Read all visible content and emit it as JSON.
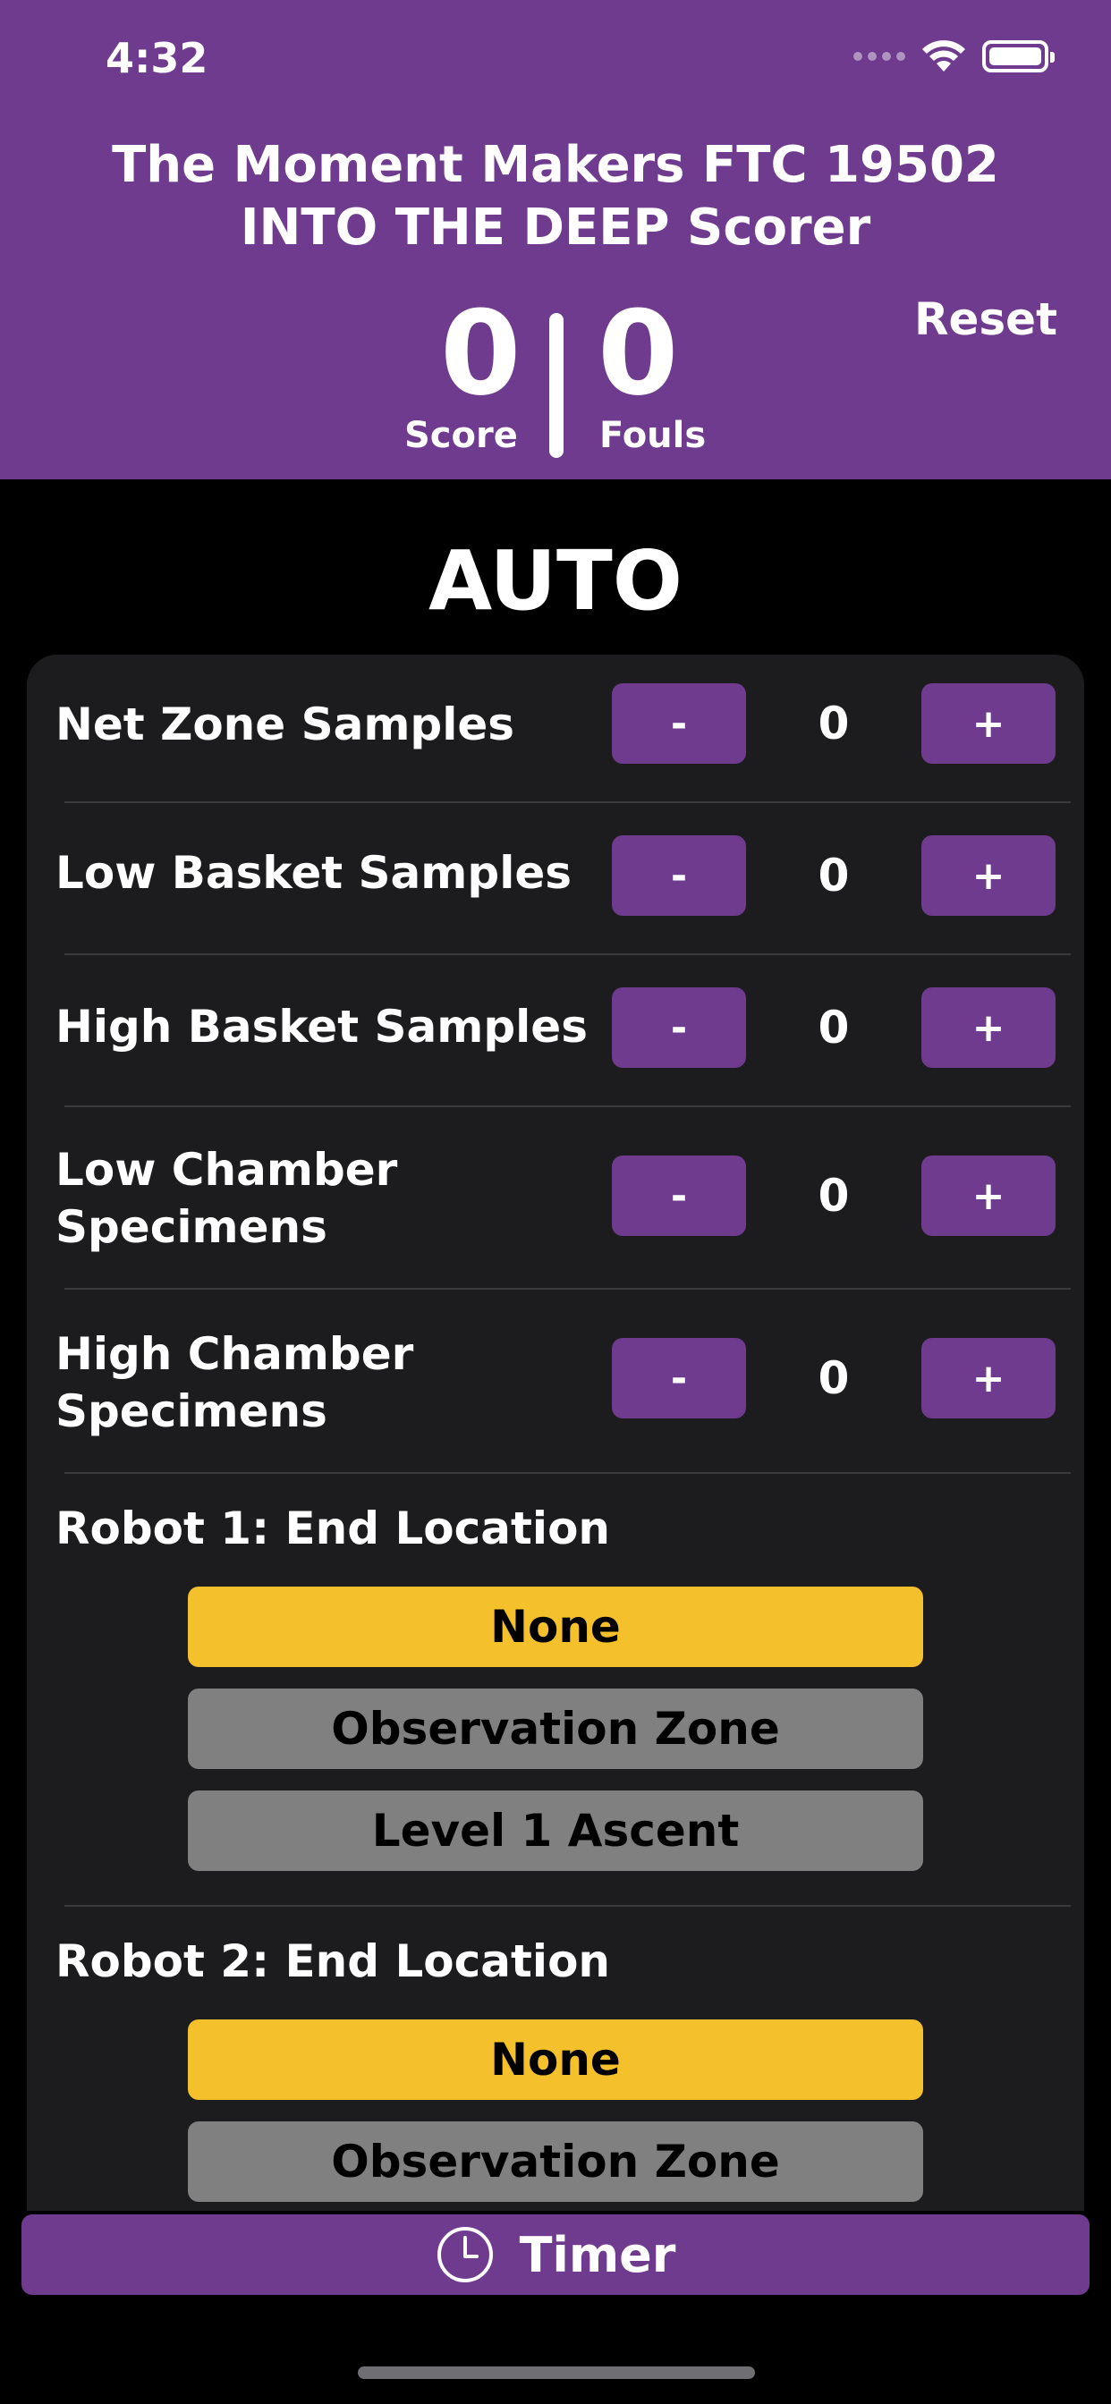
{
  "status_bar": {
    "time": "4:32"
  },
  "header": {
    "title_line1": "The Moment Makers FTC 19502",
    "title_line2": "INTO THE DEEP Scorer",
    "score_value": "0",
    "score_label": "Score",
    "fouls_value": "0",
    "fouls_label": "Fouls",
    "reset_label": "Reset"
  },
  "section": {
    "title": "AUTO"
  },
  "counters": [
    {
      "label_line1": "Net Zone Samples",
      "label_line2": "",
      "value": "0",
      "minus": "-",
      "plus": "+"
    },
    {
      "label_line1": "Low Basket Samples",
      "label_line2": "",
      "value": "0",
      "minus": "-",
      "plus": "+"
    },
    {
      "label_line1": "High Basket Samples",
      "label_line2": "",
      "value": "0",
      "minus": "-",
      "plus": "+"
    },
    {
      "label_line1": "Low Chamber",
      "label_line2": "Specimens",
      "value": "0",
      "minus": "-",
      "plus": "+"
    },
    {
      "label_line1": "High Chamber",
      "label_line2": "Specimens",
      "value": "0",
      "minus": "-",
      "plus": "+"
    }
  ],
  "robot1": {
    "label": "Robot 1: End Location",
    "options": [
      "None",
      "Observation Zone",
      "Level 1 Ascent"
    ],
    "selected": "None"
  },
  "robot2": {
    "label": "Robot 2: End Location",
    "options": [
      "None",
      "Observation Zone"
    ],
    "selected": "None"
  },
  "timer": {
    "label": "Timer"
  },
  "colors": {
    "accent": "#6f3b8e",
    "selected": "#f4c02c",
    "unselected": "#808080",
    "card": "#1c1c1e"
  }
}
